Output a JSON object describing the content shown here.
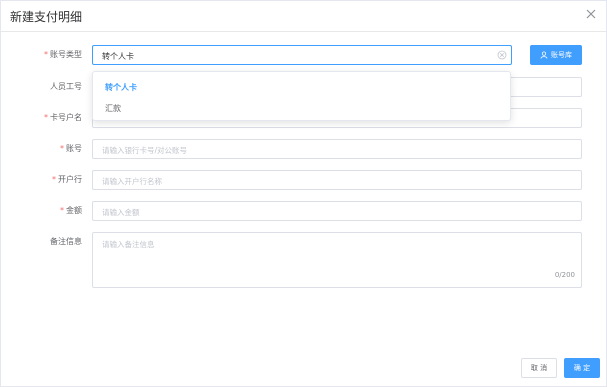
{
  "dialog": {
    "title": "新建支付明细"
  },
  "form": {
    "account_type": {
      "label": "账号类型",
      "required": true,
      "value": "转个人卡"
    },
    "employee_id": {
      "label": "人员工号",
      "required": false
    },
    "card_holder": {
      "label": "卡号户名",
      "required": true
    },
    "account": {
      "label": "账号",
      "required": true,
      "placeholder": "请输入银行卡号/对公账号"
    },
    "bank": {
      "label": "开户行",
      "required": true,
      "placeholder": "请输入开户行名称"
    },
    "amount": {
      "label": "金额",
      "required": true,
      "placeholder": "请输入金额"
    },
    "remarks": {
      "label": "备注信息",
      "required": false,
      "placeholder": "请输入备注信息",
      "counter": "0/200"
    }
  },
  "account_lib_button": "账号库",
  "dropdown": {
    "options": [
      "转个人卡",
      "汇款"
    ]
  },
  "footer": {
    "cancel": "取 消",
    "confirm": "确 定"
  },
  "colors": {
    "primary": "#409eff",
    "required": "#f56c6c"
  }
}
